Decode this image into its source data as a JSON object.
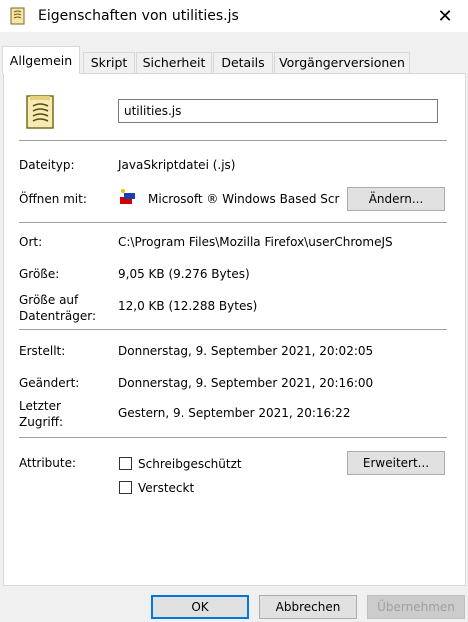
{
  "window": {
    "title": "Eigenschaften von utilities.js",
    "close_glyph": "✕"
  },
  "tabs": [
    {
      "label": "Allgemein",
      "active": true
    },
    {
      "label": "Skript"
    },
    {
      "label": "Sicherheit"
    },
    {
      "label": "Details"
    },
    {
      "label": "Vorgängerversionen"
    }
  ],
  "general": {
    "file_name": "utilities.js",
    "file_icon": "script-file-icon",
    "type_label": "Dateityp:",
    "type_value": "JavaSkriptdatei (.js)",
    "open_label": "Öffnen mit:",
    "open_value": "Microsoft ® Windows Based Scr",
    "open_icon": "windows-script-host-icon",
    "change_button": "Ändern...",
    "location_label": "Ort:",
    "location_value": "C:\\Program Files\\Mozilla Firefox\\userChromeJS",
    "size_label": "Größe:",
    "size_value": "9,05 KB (9.276 Bytes)",
    "disk_size_label_1": "Größe auf",
    "disk_size_label_2": "Datenträger:",
    "disk_size_value": "12,0 KB (12.288 Bytes)",
    "created_label": "Erstellt:",
    "created_value": "Donnerstag, 9. September 2021, 20:02:05",
    "modified_label": "Geändert:",
    "modified_value": "Donnerstag, 9. September 2021, 20:16:00",
    "accessed_label_1": "Letzter",
    "accessed_label_2": "Zugriff:",
    "accessed_value": "Gestern, 9. September 2021, 20:16:22",
    "attributes_label": "Attribute:",
    "readonly_label": "Schreibgeschützt",
    "readonly_checked": false,
    "hidden_label": "Versteckt",
    "hidden_checked": false,
    "advanced_button": "Erweitert..."
  },
  "footer": {
    "ok": "OK",
    "cancel": "Abbrechen",
    "apply": "Übernehmen"
  }
}
